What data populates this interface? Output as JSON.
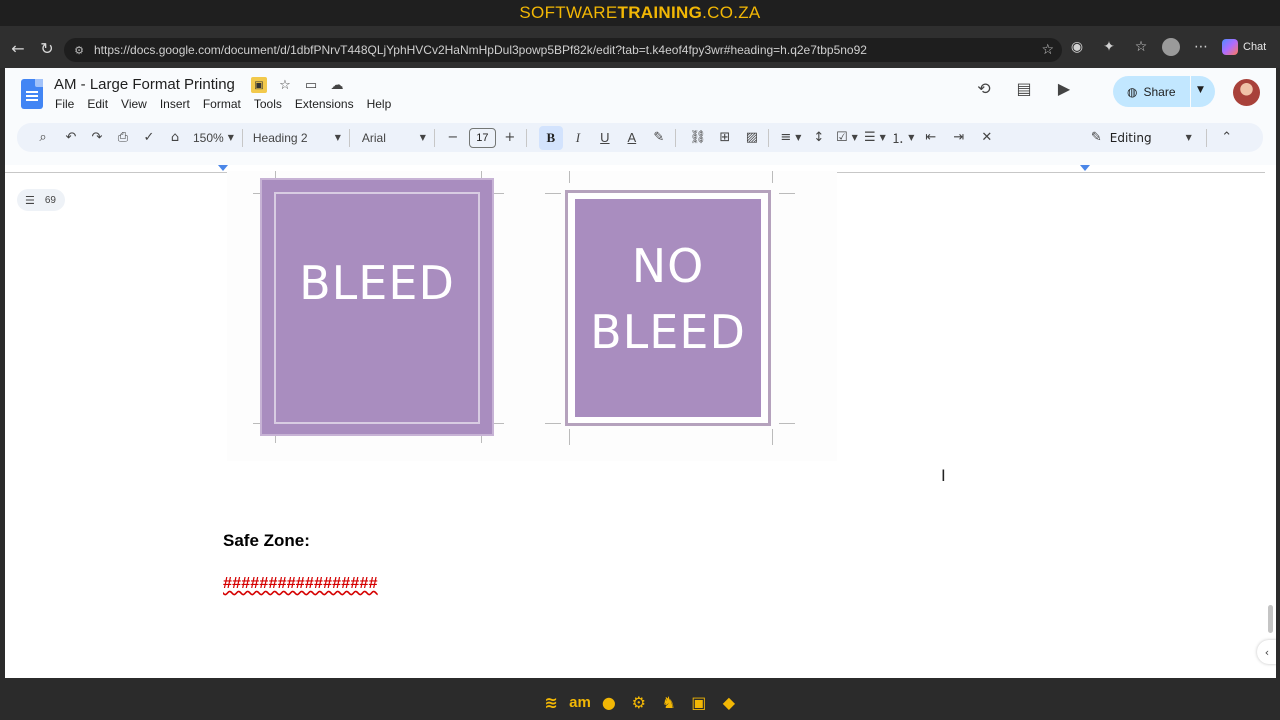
{
  "banner": {
    "part1": "SOFTWARE",
    "part2": "TRAINING",
    "part3": ".CO.ZA"
  },
  "browser": {
    "url": "https://docs.google.com/document/d/1dbfPNrvT448QLjYphHVCv2HaNmHpDul3powp5BPf82k/edit?tab=t.k4eof4fpy3wr#heading=h.q2e7tbp5no92",
    "chat_label": "Chat"
  },
  "doc": {
    "title": "AM - Large Format Printing",
    "menus": [
      "File",
      "Edit",
      "View",
      "Insert",
      "Format",
      "Tools",
      "Extensions",
      "Help"
    ],
    "share_label": "Share"
  },
  "toolbar": {
    "zoom": "150%",
    "style": "Heading 2",
    "font": "Arial",
    "font_size": "17",
    "bold": "B",
    "italic": "I",
    "underline": "U",
    "text_color": "A",
    "mode": "Editing"
  },
  "outline": {
    "count": "69"
  },
  "figure": {
    "bleed_label": "BLEED",
    "no_bleed_line1": "NO",
    "no_bleed_line2": "BLEED",
    "fill_color": "#a98dbf"
  },
  "content": {
    "heading": "Safe Zone:",
    "placeholder": "#################"
  },
  "footer": {
    "am_label": "am"
  }
}
